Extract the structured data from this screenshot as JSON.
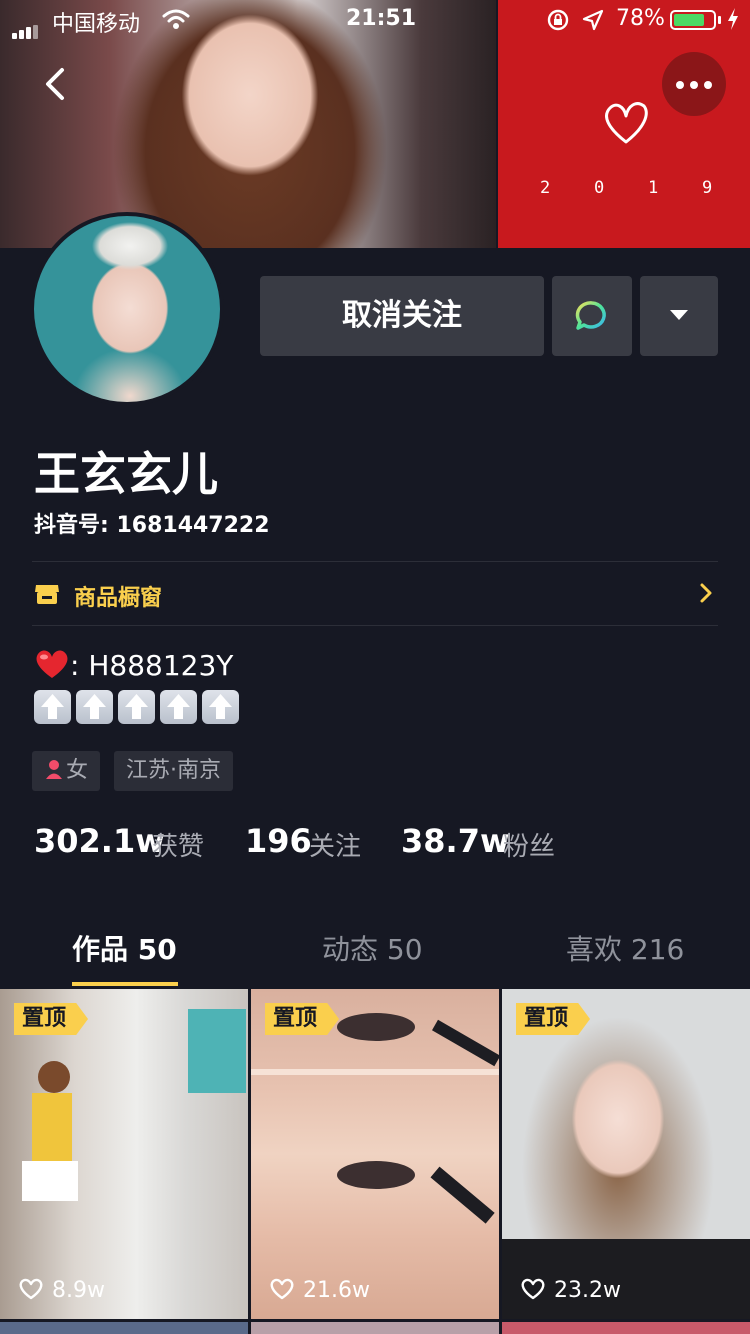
{
  "status_bar": {
    "carrier": "中国移动",
    "time": "21:51",
    "battery_percent": "78%",
    "battery_level": 0.78
  },
  "banner": {
    "year_digits": [
      "2",
      "0",
      "1",
      "9"
    ]
  },
  "profile": {
    "unfollow_label": "取消关注",
    "name": "王玄玄儿",
    "douyin_id": "抖音号: 1681447222",
    "shop_label": "商品橱窗",
    "bio_line1": ": H888123Y",
    "tags": {
      "gender": "女",
      "location": "江苏·南京"
    },
    "stats": [
      {
        "value": "302.1w",
        "label": "获赞"
      },
      {
        "value": "196",
        "label": "关注"
      },
      {
        "value": "38.7w",
        "label": "粉丝"
      }
    ]
  },
  "tabs": [
    {
      "label": "作品 50"
    },
    {
      "label": "动态 50"
    },
    {
      "label": "喜欢 216"
    }
  ],
  "videos": [
    {
      "badge": "置顶",
      "likes": "8.9w"
    },
    {
      "badge": "置顶",
      "likes": "21.6w"
    },
    {
      "badge": "置顶",
      "likes": "23.2w"
    }
  ],
  "colors": {
    "accent": "#facf4d",
    "background": "#161823",
    "button": "#393b44",
    "banner_red": "#c8191e"
  },
  "icons": [
    "back-icon",
    "more-icon",
    "heart-icon",
    "message-icon",
    "dropdown-arrow-icon",
    "shop-icon",
    "chevron-right-icon",
    "like-icon"
  ]
}
